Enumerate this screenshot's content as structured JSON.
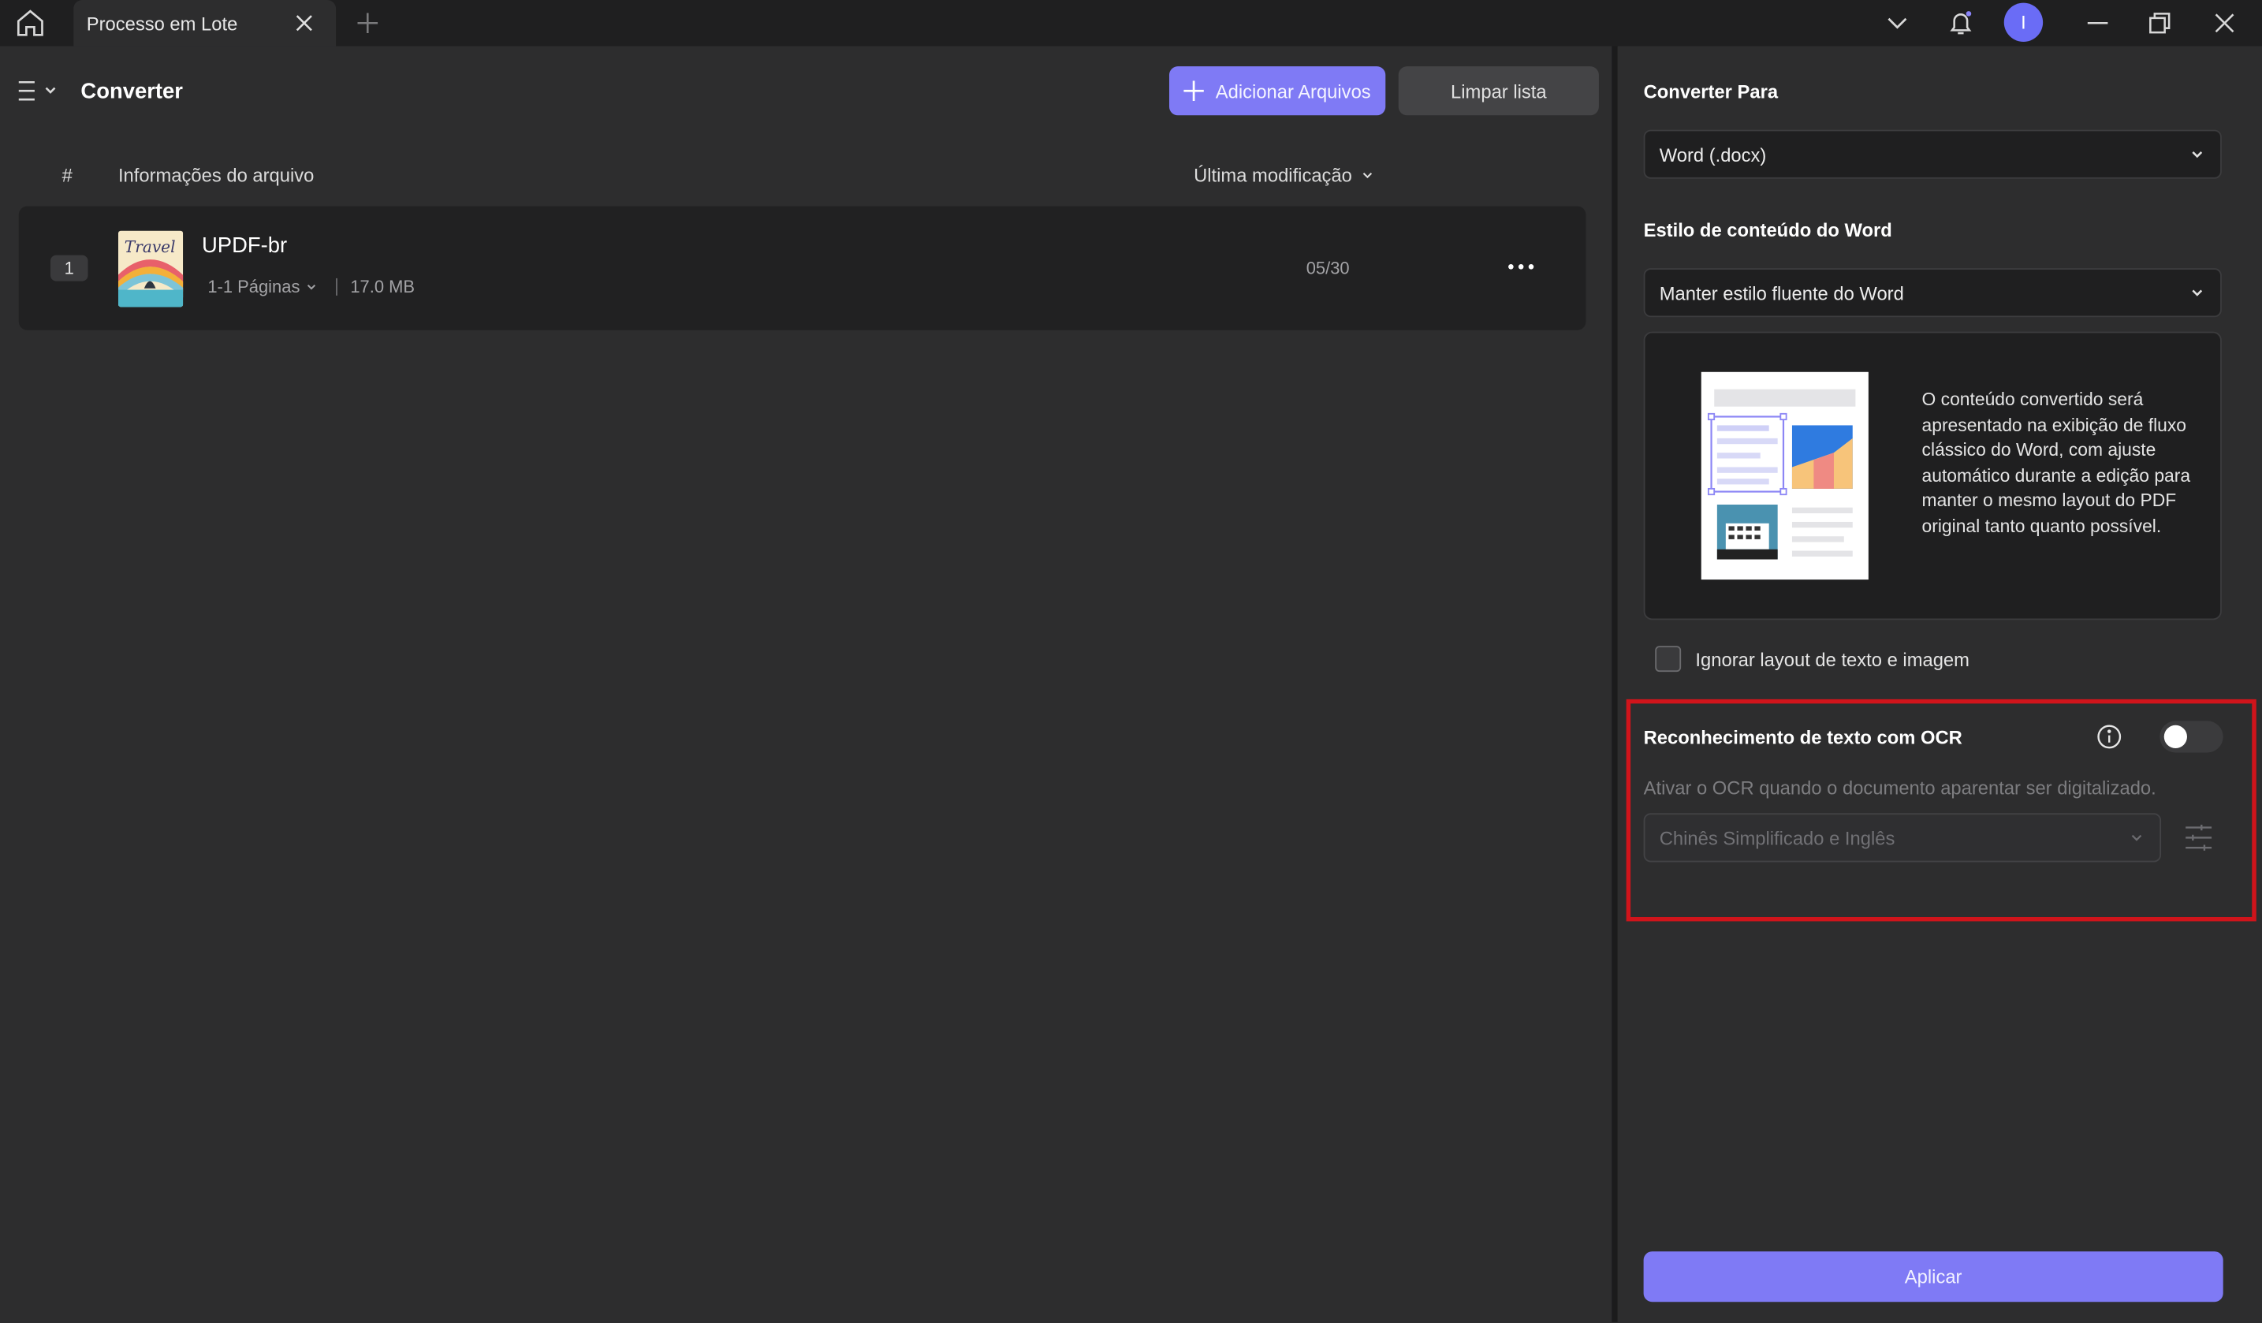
{
  "tabs": {
    "active_label": "Processo em Lote"
  },
  "header": {
    "title": "Converter",
    "add_files_label": "Adicionar Arquivos",
    "clear_list_label": "Limpar lista"
  },
  "table": {
    "col_hash": "#",
    "col_info": "Informações do arquivo",
    "col_modified": "Última modificação",
    "rows": [
      {
        "index": "1",
        "name": "UPDF-br",
        "pages": "1-1 Páginas",
        "size": "17.0 MB",
        "date": "05/30",
        "thumb_text": "Travel"
      }
    ]
  },
  "user": {
    "avatar_initial": "I"
  },
  "panel": {
    "convert_to_label": "Converter Para",
    "convert_to_value": "Word (.docx)",
    "style_label": "Estilo de conteúdo do Word",
    "style_value": "Manter estilo fluente do Word",
    "style_description": "O conteúdo convertido será apresentado na exibição de fluxo clássico do Word, com ajuste automático durante a edição para manter o mesmo layout do PDF original tanto quanto possível.",
    "ignore_layout_label": "Ignorar layout de texto e imagem",
    "ignore_layout_checked": false,
    "ocr_label": "Reconhecimento de texto com OCR",
    "ocr_enabled": false,
    "ocr_hint": "Ativar o OCR quando o documento aparentar ser digitalizado.",
    "ocr_language": "Chinês Simplificado e Inglês",
    "apply_label": "Aplicar"
  },
  "colors": {
    "accent": "#7f7af5",
    "highlight": "#d0141b",
    "avatar": "#6a6cf6"
  }
}
